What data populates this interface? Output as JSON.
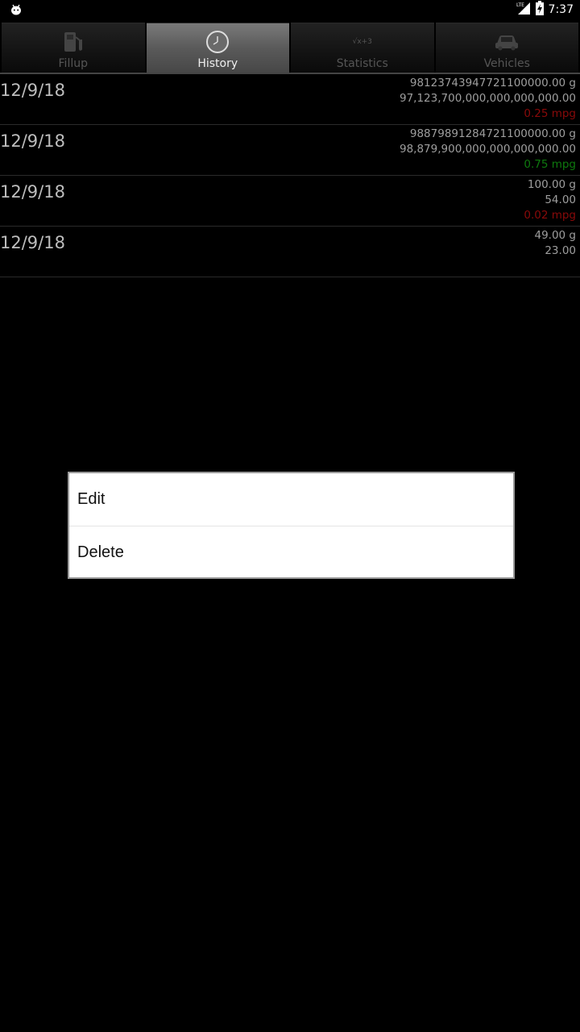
{
  "status_bar": {
    "time": "7:37",
    "network": "LTE",
    "icons": [
      "android-debug-icon",
      "lte-signal-icon",
      "battery-charging-icon"
    ]
  },
  "tabs": [
    {
      "label": "Fillup",
      "icon": "fuel-pump-icon",
      "active": false
    },
    {
      "label": "History",
      "icon": "clock-icon",
      "active": true
    },
    {
      "label": "Statistics",
      "icon": "formula-icon",
      "icon_text": "√x+3",
      "active": false
    },
    {
      "label": "Vehicles",
      "icon": "car-icon",
      "active": false
    }
  ],
  "history": [
    {
      "date": "12/9/18",
      "gallons": "98123743947721100000.00 g",
      "cost": "97,123,700,000,000,000,000.00",
      "mpg": "0.25 mpg",
      "mpg_color": "#8a0a0a"
    },
    {
      "date": "12/9/18",
      "gallons": "98879891284721100000.00 g",
      "cost": "98,879,900,000,000,000,000.00",
      "mpg": "0.75 mpg",
      "mpg_color": "#0e7a0e"
    },
    {
      "date": "12/9/18",
      "gallons": "100.00 g",
      "cost": "54.00",
      "mpg": "0.02 mpg",
      "mpg_color": "#8a0a0a"
    },
    {
      "date": "12/9/18",
      "gallons": "49.00 g",
      "cost": "23.00",
      "mpg": "",
      "mpg_color": ""
    }
  ],
  "context_menu": {
    "edit_label": "Edit",
    "delete_label": "Delete"
  }
}
